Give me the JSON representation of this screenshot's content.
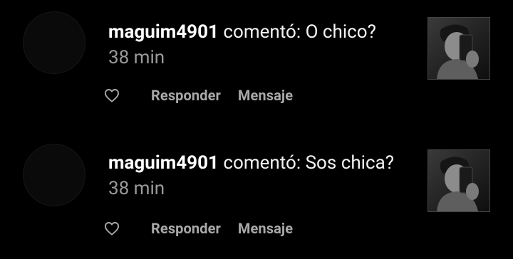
{
  "notifications": [
    {
      "username": "maguim4901",
      "action": "comentó:",
      "comment": "O chico?",
      "time": "38 min",
      "reply_label": "Responder",
      "message_label": "Mensaje",
      "like_icon": "heart-outline-icon"
    },
    {
      "username": "maguim4901",
      "action": "comentó:",
      "comment": "Sos chica?",
      "time": "38 min",
      "reply_label": "Responder",
      "message_label": "Mensaje",
      "like_icon": "heart-outline-icon"
    }
  ],
  "colors": {
    "background": "#000000",
    "primary_text": "#ffffff",
    "secondary_text": "#9a9a9a",
    "action_text": "#a8a8a8"
  }
}
